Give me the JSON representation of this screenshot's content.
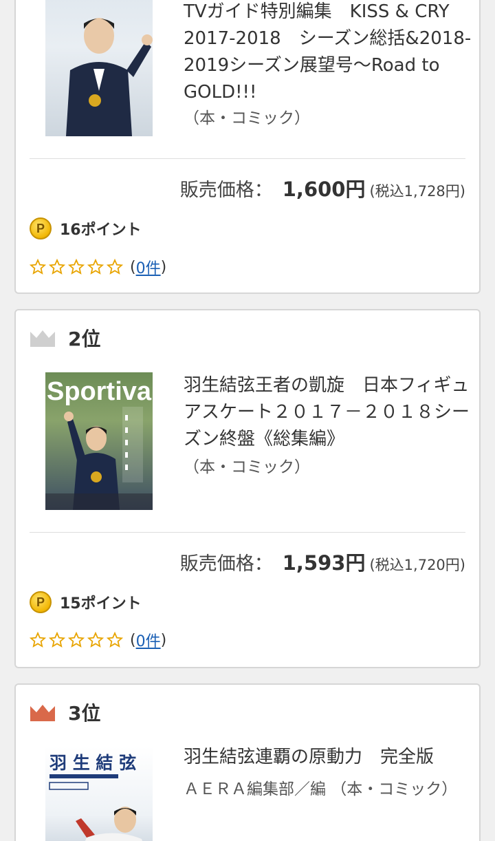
{
  "colors": {
    "crown_silver": "#cfcfcf",
    "crown_bronze": "#d9694a",
    "link": "#1a5fb4",
    "star_outline": "#e8a400"
  },
  "items": [
    {
      "title": "TVガイド特別編集　KISS & CRY 2017-2018　シーズン総括&2018-2019シーズン展望号～Road to GOLD!!!",
      "author": "（本・コミック）",
      "price_label": "販売価格：",
      "price": "1,600円",
      "price_tax": "(税込1,728円)",
      "points": "16ポイント",
      "review_open": "(",
      "review_count": "0件",
      "review_close": ")"
    },
    {
      "rank": "2位",
      "crown": "crown-silver-icon",
      "cover_text": "Sportiva",
      "title": "羽生結弦王者の凱旋　日本フィギュアスケート２０１７－２０１８シーズン終盤《総集編》",
      "author": "（本・コミック）",
      "price_label": "販売価格：",
      "price": "1,593円",
      "price_tax": "(税込1,720円)",
      "points": "15ポイント",
      "review_open": "(",
      "review_count": "0件",
      "review_close": ")"
    },
    {
      "rank": "3位",
      "crown": "crown-bronze-icon",
      "cover_text": "羽 生 結 弦",
      "title": "羽生結弦連覇の原動力　完全版",
      "author": "ＡＥＲＡ編集部／編 （本・コミック）"
    }
  ]
}
